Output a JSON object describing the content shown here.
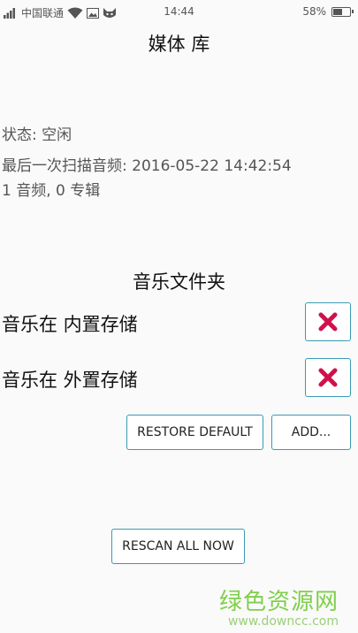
{
  "status_bar": {
    "carrier": "中国联通",
    "time": "14:44",
    "battery": "58%",
    "battery_level": 0.58
  },
  "title": "媒体 库",
  "status": "状态: 空闲",
  "last_scan": "最后一次扫描音频: 2016-05-22 14:42:54",
  "counts": "1 音频, 0 专辑",
  "folders_title": "音乐文件夹",
  "folders": [
    {
      "label": "音乐在 内置存储"
    },
    {
      "label": "音乐在 外置存储"
    }
  ],
  "buttons": {
    "restore_default": "RESTORE DEFAULT",
    "add": "ADD...",
    "rescan": "RESCAN ALL NOW"
  },
  "watermark": {
    "text": "绿色资源网",
    "url": "www.downcc.com"
  },
  "colors": {
    "accent": "#3a9bb4",
    "delete": "#d0104c"
  }
}
